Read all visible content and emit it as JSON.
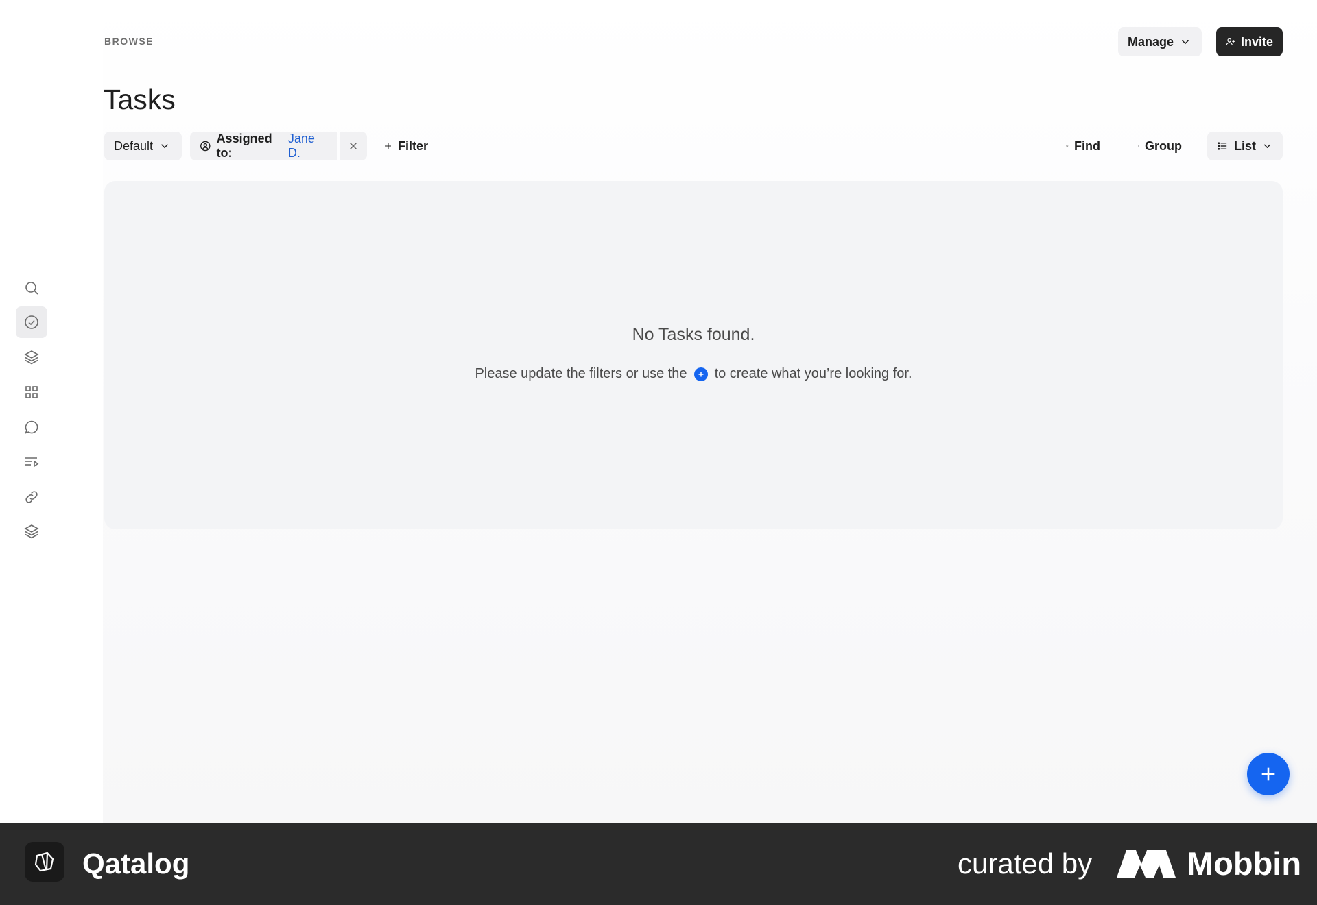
{
  "header": {
    "eyebrow": "BROWSE",
    "title": "Tasks",
    "manage_label": "Manage",
    "invite_label": "Invite"
  },
  "sidebar": {
    "items": [
      {
        "icon": "search-icon"
      },
      {
        "icon": "check-circle-icon",
        "active": true
      },
      {
        "icon": "layers-icon"
      },
      {
        "icon": "grid-icon"
      },
      {
        "icon": "chat-icon"
      },
      {
        "icon": "playlist-icon"
      },
      {
        "icon": "link-icon"
      },
      {
        "icon": "stack-icon"
      }
    ]
  },
  "toolbar": {
    "view_label": "Default",
    "assigned_label": "Assigned to:",
    "assigned_value": "Jane D.",
    "filter_label": "Filter",
    "find_label": "Find",
    "group_label": "Group",
    "layout_label": "List"
  },
  "empty_state": {
    "title": "No Tasks found.",
    "message_before": "Please update the filters or use the",
    "message_after": "to create what you’re looking for."
  },
  "footer": {
    "app_name": "Qatalog",
    "curated_by": "curated by",
    "brand": "Mobbin"
  },
  "colors": {
    "accent": "#1565f0",
    "link": "#1f5fd1",
    "footer_bg": "#2b2b2b"
  }
}
